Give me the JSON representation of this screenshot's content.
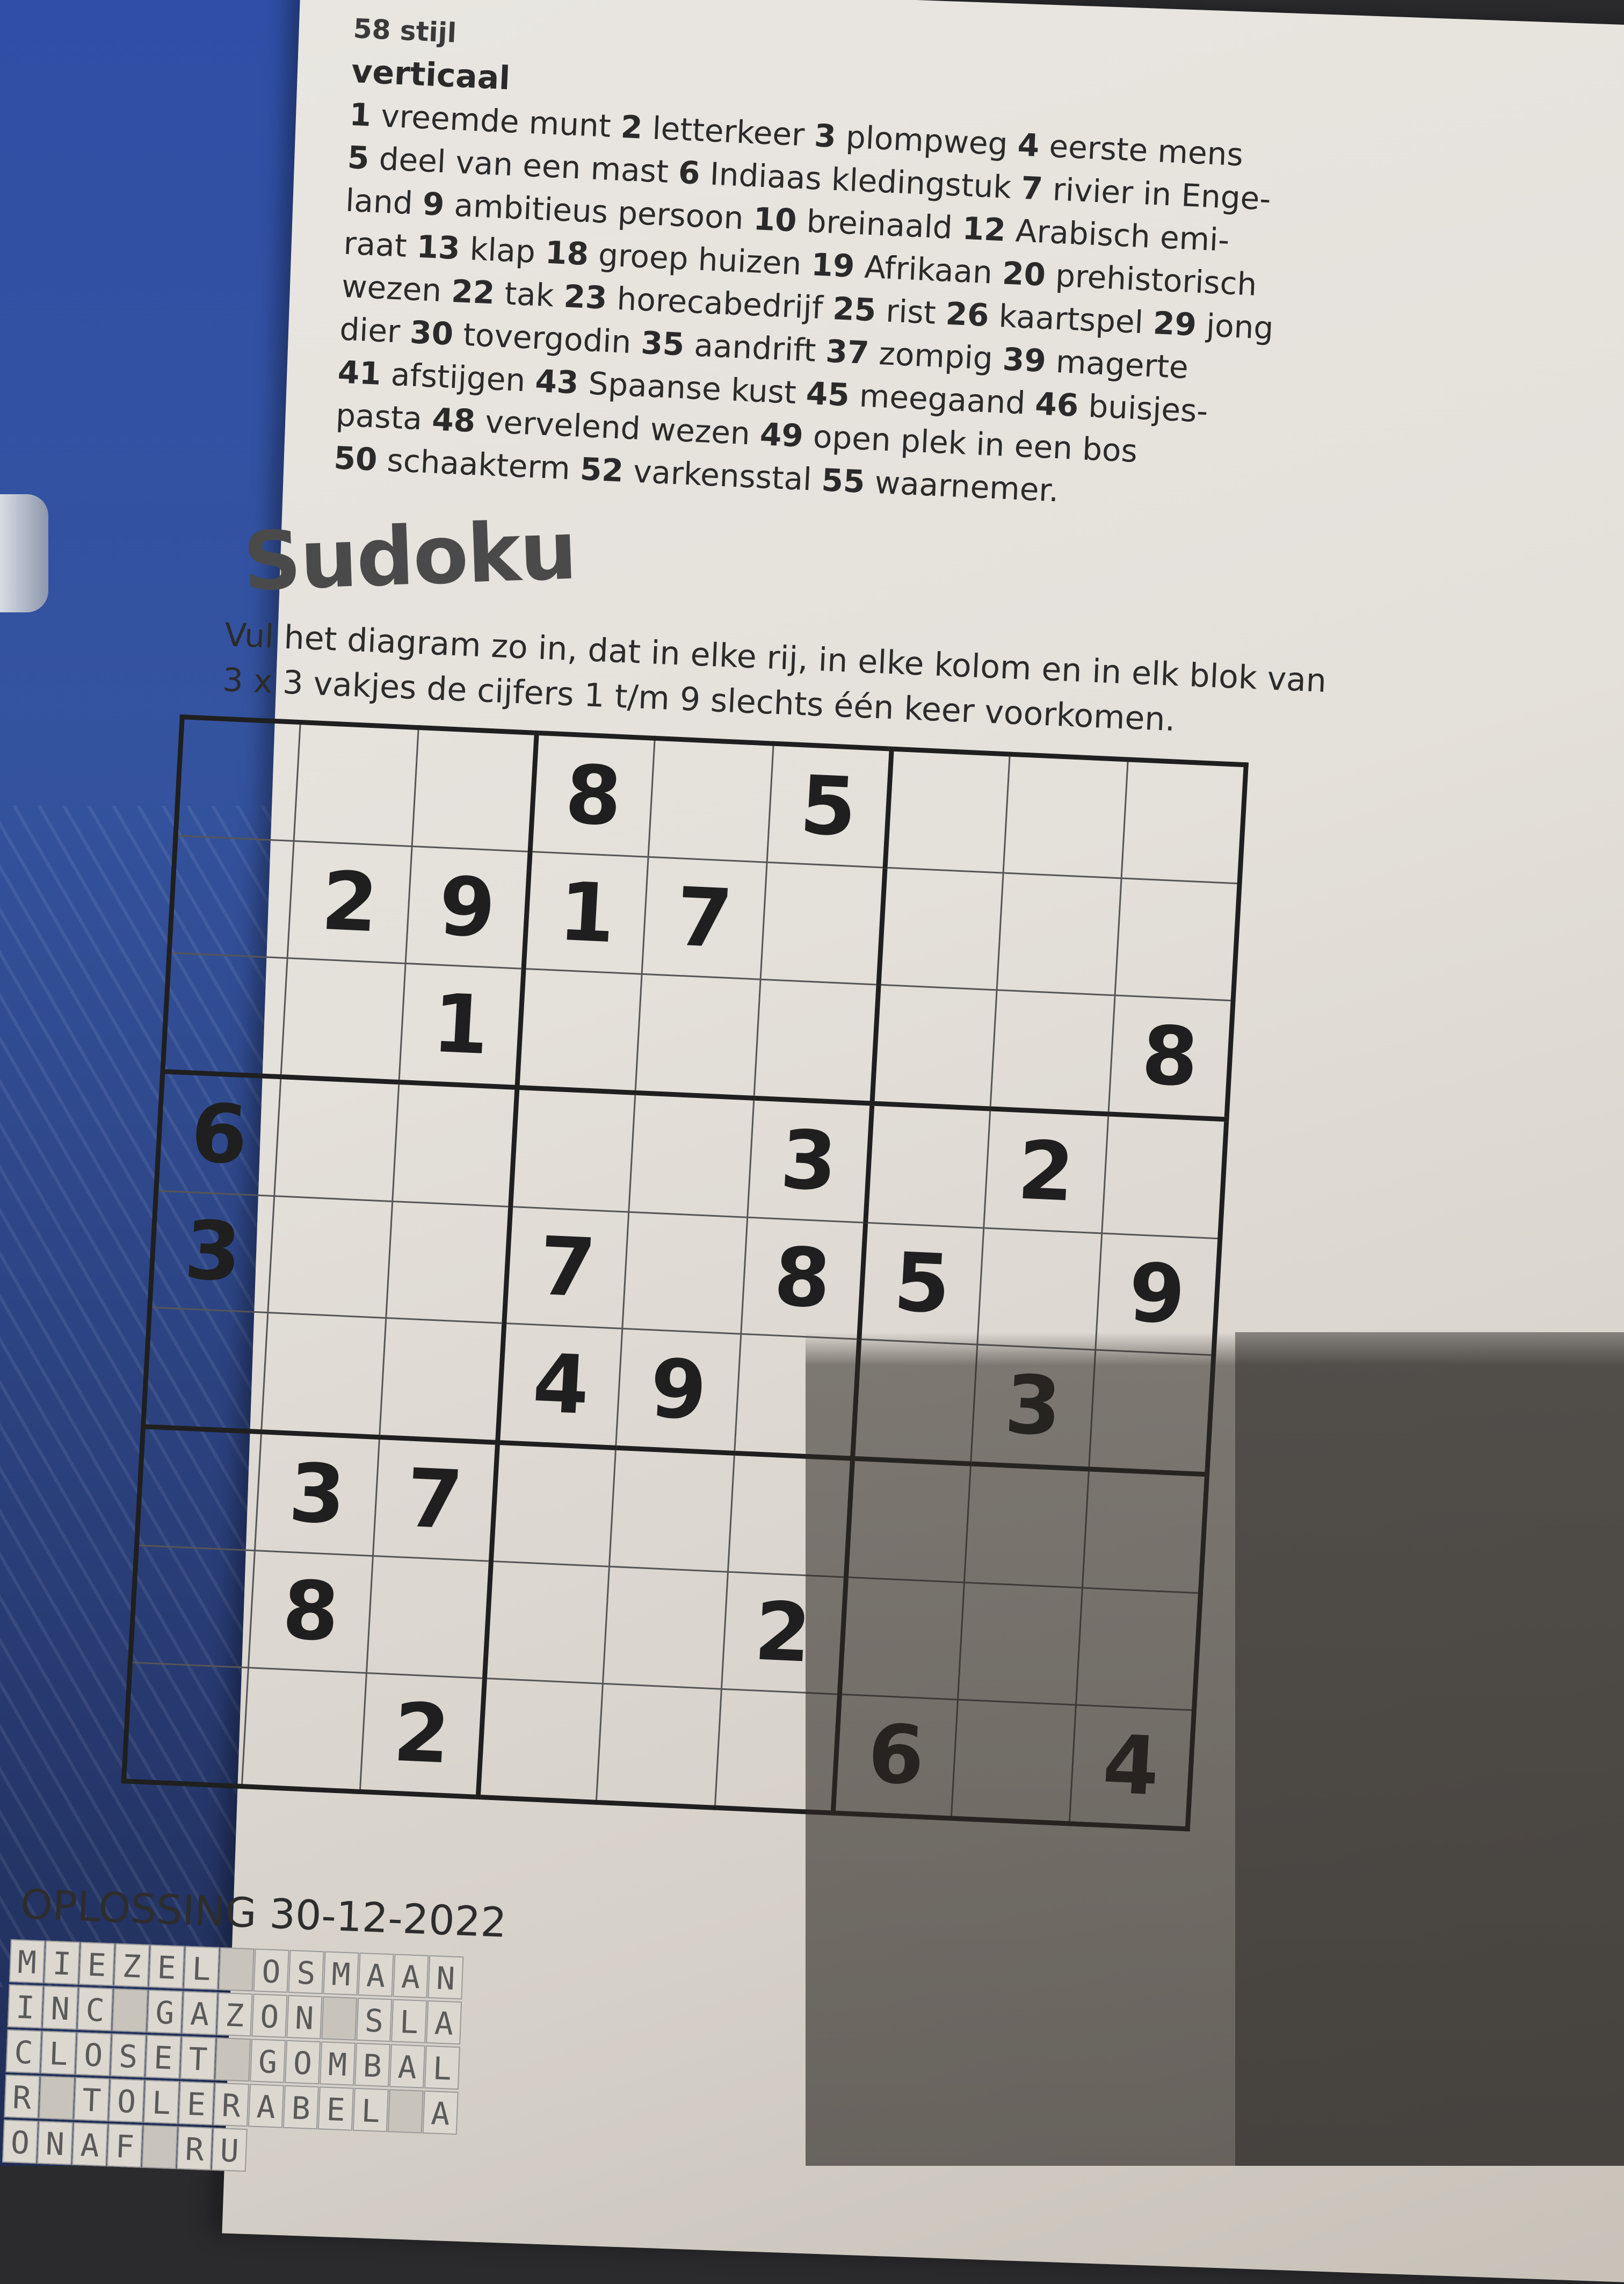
{
  "page": {
    "page_number": "58 stijl",
    "section_label": "verticaal",
    "clues": [
      {
        "n": "1",
        "text": "vreemde munt"
      },
      {
        "n": "2",
        "text": "letterkeer"
      },
      {
        "n": "3",
        "text": "plompweg"
      },
      {
        "n": "4",
        "text": "eerste mens"
      },
      {
        "n": "5",
        "text": "deel van een mast"
      },
      {
        "n": "6",
        "text": "Indiaas kledingstuk"
      },
      {
        "n": "7",
        "text": "rivier in Enge-land"
      },
      {
        "n": "9",
        "text": "ambitieus persoon"
      },
      {
        "n": "10",
        "text": "breinaald"
      },
      {
        "n": "12",
        "text": "Arabisch emi-raat"
      },
      {
        "n": "13",
        "text": "klap"
      },
      {
        "n": "18",
        "text": "groep huizen"
      },
      {
        "n": "19",
        "text": "Afrikaan"
      },
      {
        "n": "20",
        "text": "prehistorisch wezen"
      },
      {
        "n": "22",
        "text": "tak"
      },
      {
        "n": "23",
        "text": "horecabedrijf"
      },
      {
        "n": "25",
        "text": "rist"
      },
      {
        "n": "26",
        "text": "kaartspel"
      },
      {
        "n": "29",
        "text": "jong dier"
      },
      {
        "n": "30",
        "text": "tovergodin"
      },
      {
        "n": "35",
        "text": "aandrift"
      },
      {
        "n": "37",
        "text": "zompig"
      },
      {
        "n": "39",
        "text": "magerte"
      },
      {
        "n": "41",
        "text": "afstijgen"
      },
      {
        "n": "43",
        "text": "Spaanse kust"
      },
      {
        "n": "45",
        "text": "meegaand"
      },
      {
        "n": "46",
        "text": "buisjes-pasta"
      },
      {
        "n": "48",
        "text": "vervelend wezen"
      },
      {
        "n": "49",
        "text": "open plek in een bos"
      },
      {
        "n": "50",
        "text": "schaakterm"
      },
      {
        "n": "52",
        "text": "varkensstal"
      },
      {
        "n": "55",
        "text": "waarnemer."
      }
    ],
    "clue_lines": [
      "1 vreemde munt 2 letterkeer 3 plompweg 4 eerste mens",
      "5 deel van een mast 6 Indiaas kledingstuk 7 rivier in Enge-",
      "land 9 ambitieus persoon 10 breinaald 12 Arabisch emi-",
      "raat 13 klap 18 groep huizen 19 Afrikaan 20 prehistorisch",
      "wezen 22 tak 23 horecabedrijf 25 rist 26 kaartspel 29 jong",
      "dier 30 tovergodin 35 aandrift 37 zompig 39 magerte",
      "41 afstijgen 43 Spaanse kust 45 meegaand 46 buisjes-",
      "pasta 48 vervelend wezen 49 open plek in een bos",
      "50 schaakterm 52 varkensstal 55 waarnemer."
    ]
  },
  "sudoku": {
    "title": "Sudoku",
    "instructions_line1": "Vul het diagram zo in, dat in elke rij, in elke kolom en in elk blok van",
    "instructions_line2": "3 x 3 vakjes de cijfers 1 t/m 9 slechts één keer voorkomen.",
    "grid": [
      [
        "",
        "",
        "",
        "8",
        "",
        "5",
        "",
        "",
        ""
      ],
      [
        "",
        "2",
        "9",
        "1",
        "7",
        "",
        "",
        "",
        ""
      ],
      [
        "",
        "",
        "1",
        "",
        "",
        "",
        "",
        "",
        "8"
      ],
      [
        "6",
        "",
        "",
        "",
        "",
        "3",
        "",
        "2",
        ""
      ],
      [
        "3",
        "",
        "",
        "7",
        "",
        "8",
        "5",
        "",
        "9"
      ],
      [
        "",
        "",
        "",
        "4",
        "9",
        "",
        "",
        "3",
        ""
      ],
      [
        "",
        "3",
        "7",
        "",
        "",
        "",
        "",
        "",
        ""
      ],
      [
        "",
        "8",
        "",
        "",
        "",
        "2",
        "",
        "",
        ""
      ],
      [
        "",
        "",
        "2",
        "",
        "",
        "",
        "6",
        "",
        "4"
      ]
    ]
  },
  "solution": {
    "label": "OPLOSSING 30-12-2022",
    "rows": [
      "MIEZEL OSMAAN",
      "INC GAZON SLA",
      "CLOSET GOMBAL",
      "R TOLERABEL A",
      "ONAF RU"
    ]
  },
  "colors": {
    "paper": "#e6e2dc",
    "ink": "#1f1f1f",
    "cover_blue": "#2f4fa6"
  }
}
